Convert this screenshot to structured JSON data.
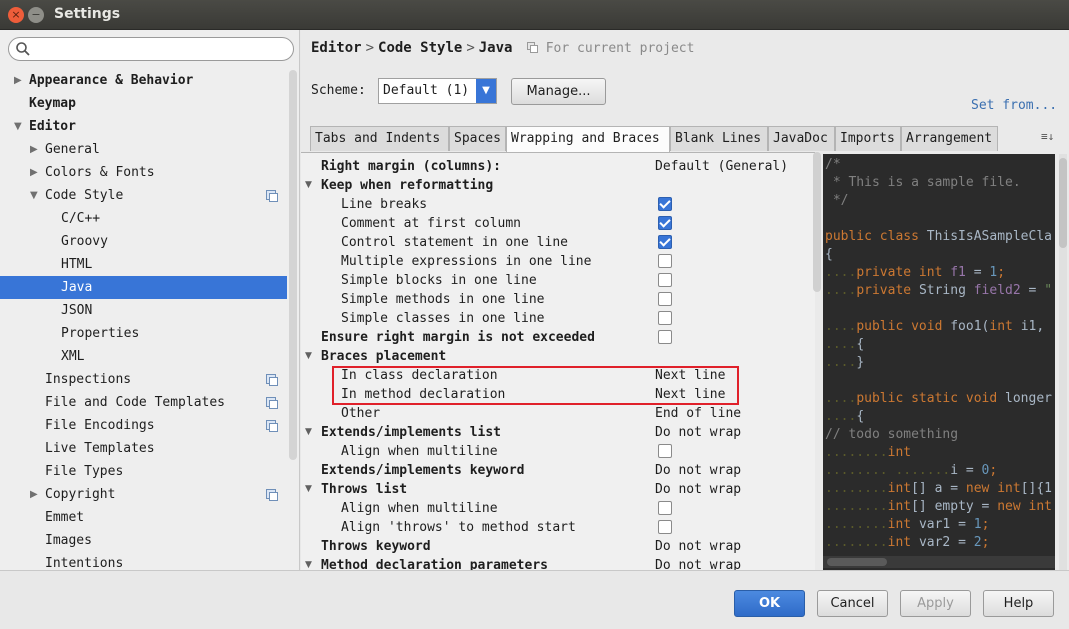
{
  "window": {
    "title": "Settings",
    "close_glyph": "×",
    "minimize_glyph": "−"
  },
  "search": {
    "placeholder": ""
  },
  "sidebar": {
    "items": [
      {
        "label": "Appearance & Behavior",
        "arrow": "▶"
      },
      {
        "label": "Keymap"
      },
      {
        "label": "Editor",
        "arrow": "▼"
      },
      {
        "label": "General",
        "arrow": "▶"
      },
      {
        "label": "Colors & Fonts",
        "arrow": "▶"
      },
      {
        "label": "Code Style",
        "arrow": "▼"
      },
      {
        "label": "C/C++"
      },
      {
        "label": "Groovy"
      },
      {
        "label": "HTML"
      },
      {
        "label": "Java"
      },
      {
        "label": "JSON"
      },
      {
        "label": "Properties"
      },
      {
        "label": "XML"
      },
      {
        "label": "Inspections"
      },
      {
        "label": "File and Code Templates"
      },
      {
        "label": "File Encodings"
      },
      {
        "label": "Live Templates"
      },
      {
        "label": "File Types"
      },
      {
        "label": "Copyright",
        "arrow": "▶"
      },
      {
        "label": "Emmet"
      },
      {
        "label": "Images"
      },
      {
        "label": "Intentions"
      }
    ]
  },
  "breadcrumb": {
    "part1": "Editor",
    "sep": ">",
    "part2": "Code Style",
    "part3": "Java",
    "project_note": "For current project"
  },
  "scheme": {
    "label": "Scheme:",
    "value": "Default (1)",
    "manage_label": "Manage...",
    "set_from_label": "Set from..."
  },
  "tabs": [
    "Tabs and Indents",
    "Spaces",
    "Wrapping and Braces",
    "Blank Lines",
    "JavaDoc",
    "Imports",
    "Arrangement"
  ],
  "tab_menu": "≡↓",
  "settings": {
    "rows": [
      {
        "name": "Right margin (columns):",
        "value": "Default (General)"
      },
      {
        "name": "Keep when reformatting",
        "tri": "▼"
      },
      {
        "name": "Line breaks",
        "checked": true
      },
      {
        "name": "Comment at first column",
        "checked": true
      },
      {
        "name": "Control statement in one line",
        "checked": true
      },
      {
        "name": "Multiple expressions in one line",
        "checked": false
      },
      {
        "name": "Simple blocks in one line",
        "checked": false
      },
      {
        "name": "Simple methods in one line",
        "checked": false
      },
      {
        "name": "Simple classes in one line",
        "checked": false
      },
      {
        "name": "Ensure right margin is not exceeded",
        "checked": false
      },
      {
        "name": "Braces placement",
        "tri": "▼"
      },
      {
        "name": "In class declaration",
        "value": "Next line"
      },
      {
        "name": "In method declaration",
        "value": "Next line"
      },
      {
        "name": "Other",
        "value": "End of line"
      },
      {
        "name": "Extends/implements list",
        "tri": "▼",
        "value": "Do not wrap"
      },
      {
        "name": "Align when multiline",
        "checked": false
      },
      {
        "name": "Extends/implements keyword",
        "value": "Do not wrap"
      },
      {
        "name": "Throws list",
        "tri": "▼",
        "value": "Do not wrap"
      },
      {
        "name": "Align when multiline",
        "checked": false
      },
      {
        "name": "Align 'throws' to method start",
        "checked": false
      },
      {
        "name": "Throws keyword",
        "value": "Do not wrap"
      },
      {
        "name": "Method declaration parameters",
        "tri": "▼",
        "value": "Do not wrap"
      }
    ]
  },
  "code_preview": {
    "l1": "/*",
    "l2": " * This is a sample file.",
    "l3": " */",
    "class_kw": "public class ",
    "class_name": "ThisIsASampleCla",
    "brace_open": "{",
    "f1_private": "private int ",
    "f1_name": "f1",
    "f1_eq": " = ",
    "f1_val": "1",
    "f1_end": ";",
    "f2_private": "private ",
    "f2_type": "String ",
    "f2_name": "field2",
    "f2_eq": " = ",
    "f2_val": "\"",
    "foo1_kw": "public void ",
    "foo1_rest": "foo1(",
    "foo1_int": "int ",
    "foo1_arg": "i1,",
    "ob": "{",
    "cb": "}",
    "longer_kw": "public static void ",
    "longer_name": "longer",
    "ob2": "{",
    "todo": "// todo something",
    "int_kw": "int",
    "i_name": "i",
    "i_eq": " = ",
    "i_val": "0",
    "i_end": ";",
    "a_kw": "int",
    "a_mid": "[] a = ",
    "a_new": "new int",
    "a_end": "[]{1",
    "e_kw": "int",
    "e_mid": "[] empty = ",
    "e_new": "new int",
    "v1_kw": "int ",
    "v1_name": "var1 = ",
    "v1_val": "1",
    "v1_end": ";",
    "v2_kw": "int ",
    "v2_name": "var2 = ",
    "v2_val": "2",
    "v2_end": ";",
    "dots4": "....",
    "dots8": "........",
    "dots16": "........ ......."
  },
  "footer": {
    "ok": "OK",
    "cancel": "Cancel",
    "apply": "Apply",
    "help": "Help"
  }
}
